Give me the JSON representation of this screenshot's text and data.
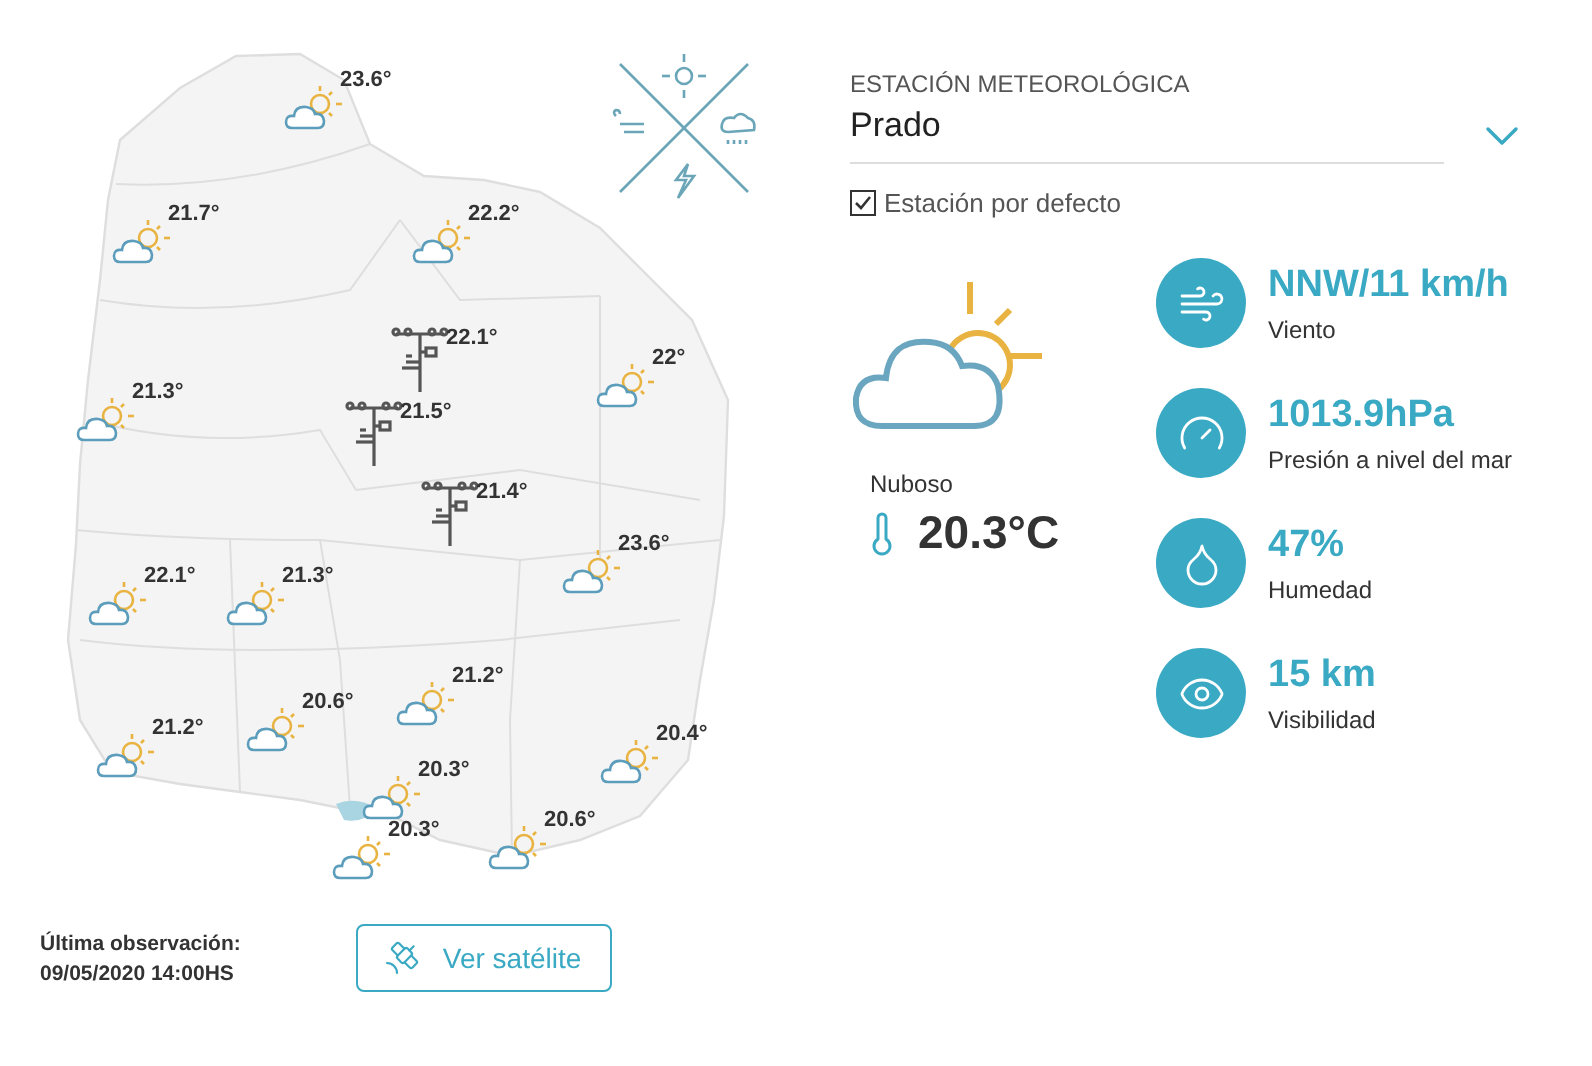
{
  "map": {
    "markers": [
      {
        "kind": "partly_cloudy",
        "temp": "23.6°"
      },
      {
        "kind": "partly_cloudy",
        "temp": "21.7°"
      },
      {
        "kind": "partly_cloudy",
        "temp": "22.2°"
      },
      {
        "kind": "station",
        "temp": "22.1°"
      },
      {
        "kind": "partly_cloudy",
        "temp": "21.3°"
      },
      {
        "kind": "partly_cloudy",
        "temp": "22°"
      },
      {
        "kind": "station",
        "temp": "21.5°"
      },
      {
        "kind": "station",
        "temp": "21.4°"
      },
      {
        "kind": "partly_cloudy",
        "temp": "23.6°"
      },
      {
        "kind": "partly_cloudy",
        "temp": "22.1°"
      },
      {
        "kind": "partly_cloudy",
        "temp": "21.3°"
      },
      {
        "kind": "partly_cloudy",
        "temp": "21.2°"
      },
      {
        "kind": "partly_cloudy",
        "temp": "20.6°"
      },
      {
        "kind": "partly_cloudy",
        "temp": "21.2°"
      },
      {
        "kind": "partly_cloudy",
        "temp": "20.4°"
      },
      {
        "kind": "partly_cloudy",
        "temp": "20.3°"
      },
      {
        "kind": "partly_cloudy",
        "temp": "20.3°"
      },
      {
        "kind": "partly_cloudy",
        "temp": "20.6°"
      }
    ]
  },
  "station": {
    "label": "ESTACIÓN METEOROLÓGICA",
    "value": "Prado"
  },
  "default_station": {
    "label": "Estación por defecto",
    "checked": true
  },
  "current": {
    "condition": "Nuboso",
    "temperature": "20.3°C"
  },
  "stats": [
    {
      "kind": "wind",
      "value": "NNW/11 km/h",
      "label": "Viento"
    },
    {
      "kind": "pressure",
      "value": "1013.9hPa",
      "label": "Presión a nivel del mar"
    },
    {
      "kind": "humidity",
      "value": "47%",
      "label": "Humedad"
    },
    {
      "kind": "visibility",
      "value": "15 km",
      "label": "Visibilidad"
    }
  ],
  "last_observation": {
    "label": "Última observación:",
    "time": "09/05/2020 14:00HS"
  },
  "satellite_button": "Ver satélite"
}
